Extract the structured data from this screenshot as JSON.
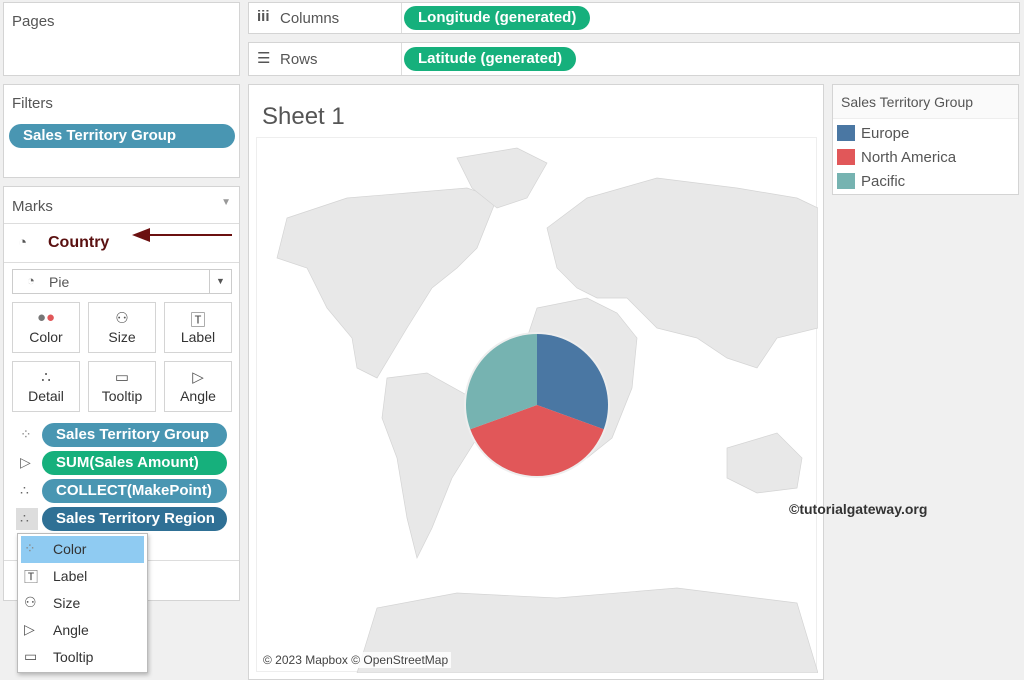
{
  "pages": {
    "title": "Pages"
  },
  "filters": {
    "title": "Filters",
    "pill": "Sales Territory Group"
  },
  "columns": {
    "label": "Columns",
    "pill": "Longitude (generated)"
  },
  "rows": {
    "label": "Rows",
    "pill": "Latitude (generated)"
  },
  "marks": {
    "title": "Marks",
    "layer": "Country",
    "mark_type": "Pie",
    "cards": [
      "Color",
      "Size",
      "Label",
      "Detail",
      "Tooltip",
      "Angle"
    ],
    "fields": [
      "Sales Territory Group",
      "SUM(Sales Amount)",
      "COLLECT(MakePoint)",
      "Sales Territory Region"
    ]
  },
  "menu": {
    "items": [
      "Color",
      "Label",
      "Size",
      "Angle",
      "Tooltip"
    ],
    "selected": "Color"
  },
  "sheet": {
    "title": "Sheet 1",
    "attribution": "© 2023 Mapbox © OpenStreetMap",
    "watermark": "©tutorialgateway.org"
  },
  "legend": {
    "title": "Sales Territory Group",
    "items": [
      {
        "label": "Europe",
        "color": "#4a77a3"
      },
      {
        "label": "North America",
        "color": "#e15759"
      },
      {
        "label": "Pacific",
        "color": "#76b3b1"
      }
    ]
  },
  "chart_data": {
    "type": "pie",
    "categories": [
      "Europe",
      "North America",
      "Pacific"
    ],
    "values": [
      110,
      140,
      110
    ],
    "colors": [
      "#4a77a3",
      "#e15759",
      "#76b3b1"
    ]
  }
}
